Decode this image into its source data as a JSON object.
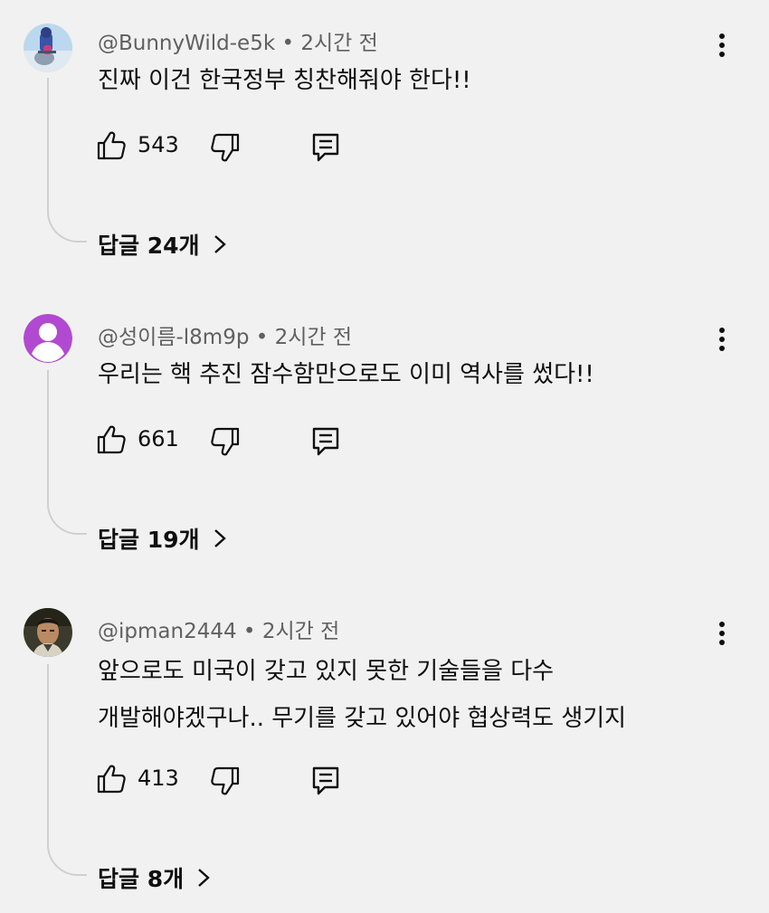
{
  "colors": {
    "background": "#f1f1f1",
    "text": "#0f0f0f",
    "meta_text": "#606060",
    "thread_line": "#d0d0d0",
    "default_avatar": "#b14ad1"
  },
  "comments": [
    {
      "author": "@BunnyWild-e5k",
      "time": "2시간 전",
      "text_lines": [
        "진짜 이건 한국정부 칭찬해줘야 한다!!"
      ],
      "likes": "543",
      "replies": "답글 24개",
      "avatar": "bunny-avatar-image"
    },
    {
      "author": "@성이름-l8m9p",
      "time": "2시간 전",
      "text_lines": [
        "우리는 핵 추진 잠수함만으로도 이미 역사를 썼다!!"
      ],
      "likes": "661",
      "replies": "답글 19개",
      "avatar": "default-person-icon"
    },
    {
      "author": "@ipman2444",
      "time": "2시간 전",
      "text_lines": [
        "앞으로도 미국이 갖고 있지 못한 기술들을 다수",
        "개발해야겠구나.. 무기를 갖고 있어야 협상력도 생기지"
      ],
      "likes": "413",
      "replies": "답글 8개",
      "avatar": "ipman-avatar-image"
    }
  ],
  "icons": {
    "like": "thumbs-up-icon",
    "dislike": "thumbs-down-icon",
    "reply": "reply-comment-icon",
    "more": "more-vert-icon",
    "chevron": "chevron-right-icon"
  }
}
